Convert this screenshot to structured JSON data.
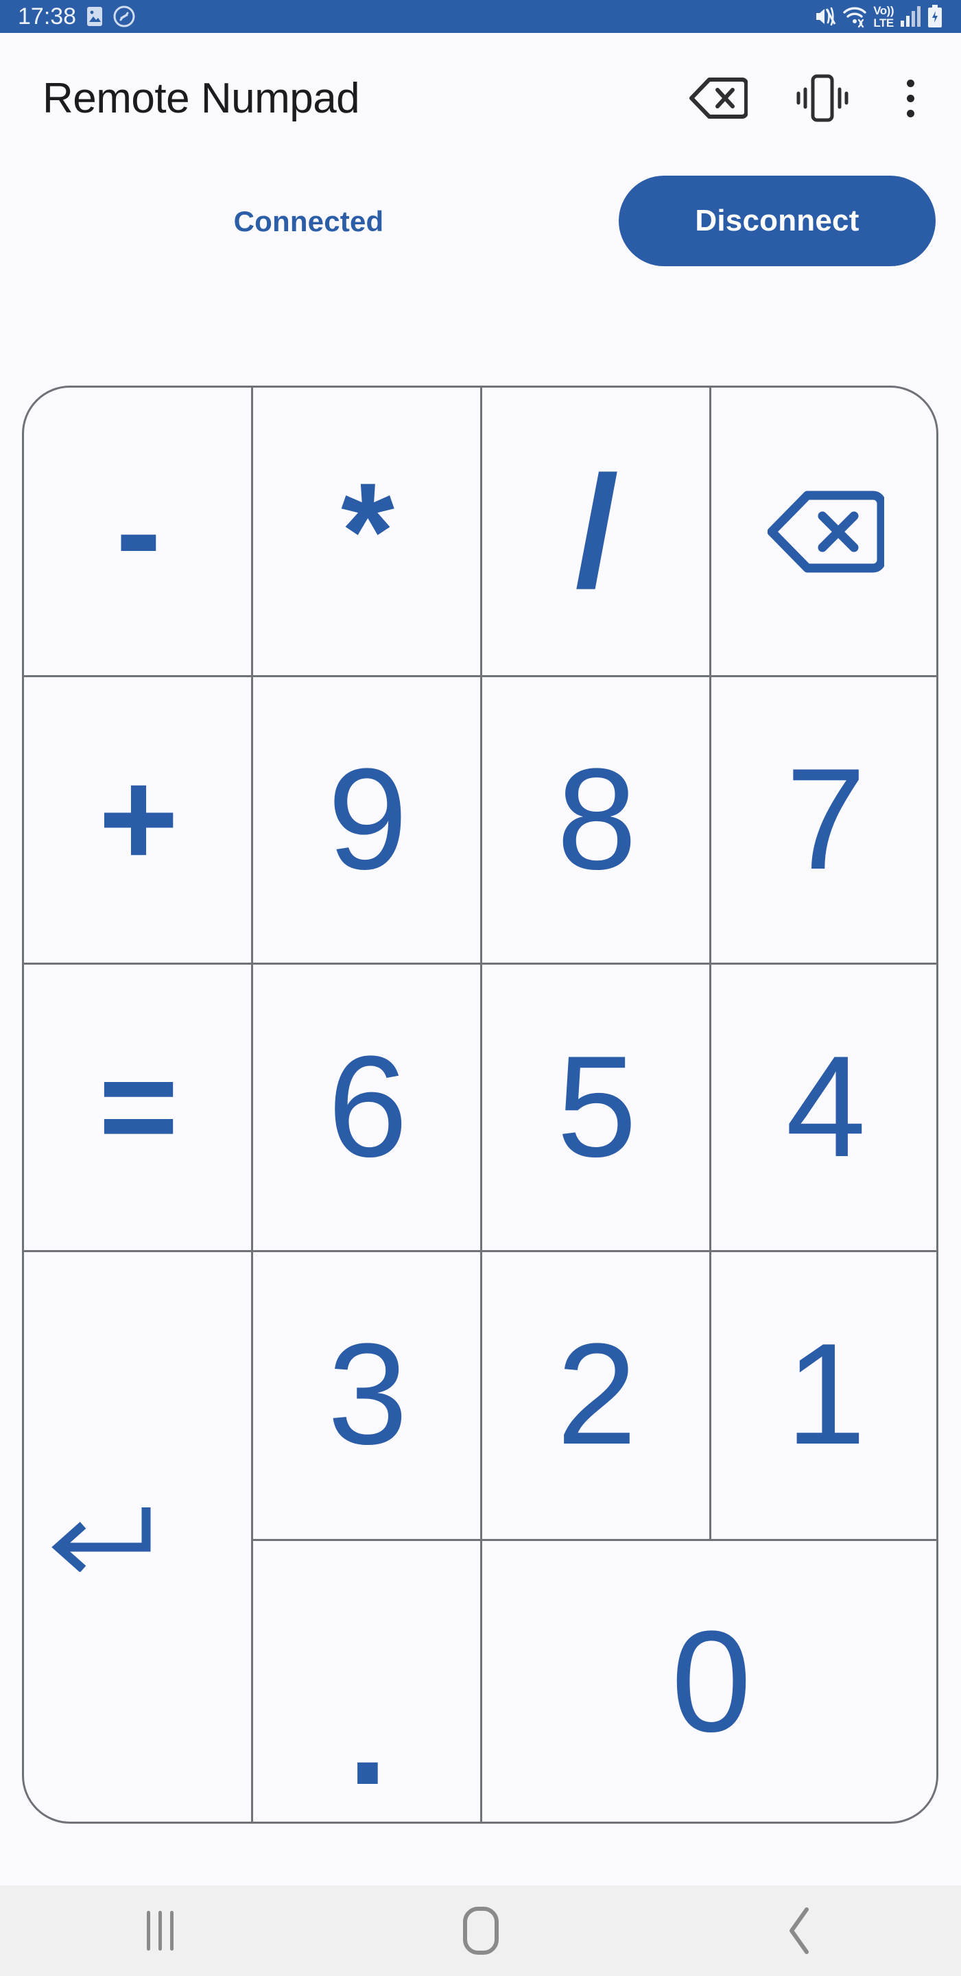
{
  "status_bar": {
    "time": "17:38",
    "left_icons": [
      "image-icon",
      "shazam-icon"
    ],
    "right_icons": [
      "mute-vibrate-icon",
      "wifi-icon",
      "volte-icon",
      "cellular-signal-icon",
      "battery-charging-icon"
    ],
    "volte_top": "Vo))",
    "volte_bottom": "LTE",
    "background_color": "#2b5ea6"
  },
  "app_bar": {
    "title": "Remote Numpad",
    "actions": [
      {
        "name": "backspace-action",
        "icon": "backspace-icon"
      },
      {
        "name": "vibrate-action",
        "icon": "vibrate-icon"
      },
      {
        "name": "overflow-menu",
        "icon": "kebab-menu-icon"
      }
    ]
  },
  "connection": {
    "status_text": "Connected",
    "status_color": "#2b5ea6",
    "button_label": "Disconnect",
    "button_color": "#2b5ca8"
  },
  "keypad": {
    "accent_color": "#2b5ca8",
    "border_color": "#6f7277",
    "keys": [
      {
        "id": "minus",
        "label": "-",
        "icon": null,
        "name": "key-minus",
        "row": 1,
        "col": 1
      },
      {
        "id": "asterisk",
        "label": "*",
        "icon": null,
        "name": "key-asterisk",
        "row": 1,
        "col": 2
      },
      {
        "id": "slash",
        "label": "/",
        "icon": null,
        "name": "key-slash",
        "row": 1,
        "col": 3
      },
      {
        "id": "backspace",
        "label": "",
        "icon": "backspace-icon",
        "name": "key-backspace",
        "row": 1,
        "col": 4
      },
      {
        "id": "plus",
        "label": "+",
        "icon": null,
        "name": "key-plus",
        "row": 2,
        "col": 1
      },
      {
        "id": "nine",
        "label": "9",
        "icon": null,
        "name": "key-9",
        "row": 2,
        "col": 2
      },
      {
        "id": "eight",
        "label": "8",
        "icon": null,
        "name": "key-8",
        "row": 2,
        "col": 3
      },
      {
        "id": "seven",
        "label": "7",
        "icon": null,
        "name": "key-7",
        "row": 2,
        "col": 4
      },
      {
        "id": "equals",
        "label": "=",
        "icon": null,
        "name": "key-equals",
        "row": 3,
        "col": 1
      },
      {
        "id": "six",
        "label": "6",
        "icon": null,
        "name": "key-6",
        "row": 3,
        "col": 2
      },
      {
        "id": "five",
        "label": "5",
        "icon": null,
        "name": "key-5",
        "row": 3,
        "col": 3
      },
      {
        "id": "four",
        "label": "4",
        "icon": null,
        "name": "key-4",
        "row": 3,
        "col": 4
      },
      {
        "id": "enter",
        "label": "",
        "icon": "enter-arrow-icon",
        "name": "key-enter",
        "row": 4,
        "col": 1,
        "rowspan": 2
      },
      {
        "id": "three",
        "label": "3",
        "icon": null,
        "name": "key-3",
        "row": 4,
        "col": 2
      },
      {
        "id": "two",
        "label": "2",
        "icon": null,
        "name": "key-2",
        "row": 4,
        "col": 3
      },
      {
        "id": "one",
        "label": "1",
        "icon": null,
        "name": "key-1",
        "row": 4,
        "col": 4
      },
      {
        "id": "period",
        "label": ".",
        "icon": null,
        "name": "key-period",
        "row": 5,
        "col": 2
      },
      {
        "id": "zero",
        "label": "0",
        "icon": null,
        "name": "key-0",
        "row": 5,
        "col": 3,
        "colspan": 2
      }
    ]
  },
  "nav_bar": {
    "buttons": [
      {
        "name": "nav-recents-button",
        "icon": "recents-icon"
      },
      {
        "name": "nav-home-button",
        "icon": "home-icon"
      },
      {
        "name": "nav-back-button",
        "icon": "back-chevron-icon"
      }
    ]
  }
}
